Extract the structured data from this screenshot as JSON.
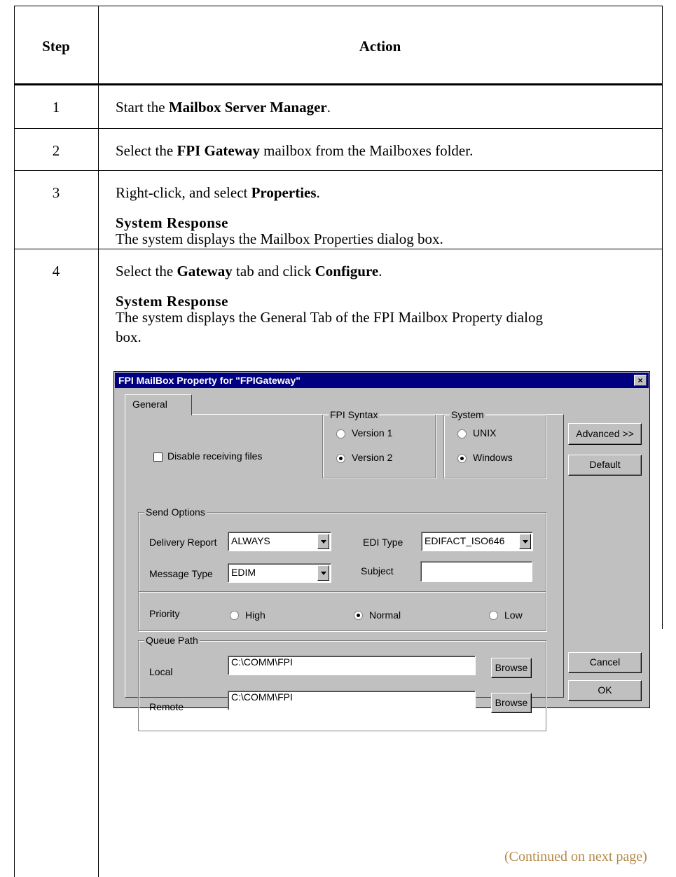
{
  "table": {
    "header_step": "Step",
    "header_action": "Action",
    "rows": [
      {
        "step": "1",
        "pre": "Start the ",
        "bold": "Mailbox Server Manager",
        "post": "."
      },
      {
        "step": "2",
        "pre": "Select the ",
        "bold": "FPI Gateway",
        "post": " mailbox from the Mailboxes folder."
      },
      {
        "step": "3",
        "pre": "Right-click, and select ",
        "bold": "Properties",
        "post": ".",
        "response_heading": "System Response",
        "response_text": "The system displays the Mailbox Properties dialog box."
      },
      {
        "step": "4",
        "pre": "Select the ",
        "bold": "Gateway",
        "mid": " tab and click ",
        "bold2": "Configure",
        "post": ".",
        "response_heading": "System Response",
        "response_text_line1": "The system displays the General Tab of the FPI Mailbox Property dialog",
        "response_text_line2": "box."
      }
    ],
    "continued": "(Continued on next page)"
  },
  "dialog": {
    "title": "FPI MailBox Property for \"FPIGateway\"",
    "close_symbol": "×",
    "tab_general": "General",
    "disable_receiving": "Disable receiving files",
    "fpi_syntax": {
      "label": "FPI Syntax",
      "v1": "Version 1",
      "v2": "Version 2",
      "selected": "Version 2"
    },
    "system": {
      "label": "System",
      "unix": "UNIX",
      "windows": "Windows",
      "selected": "Windows"
    },
    "send_options": {
      "label": "Send Options",
      "delivery_report_label": "Delivery Report",
      "delivery_report_value": "ALWAYS",
      "edi_type_label": "EDI Type",
      "edi_type_value": "EDIFACT_ISO646",
      "message_type_label": "Message Type",
      "message_type_value": "EDIM",
      "subject_label": "Subject",
      "subject_value": "",
      "priority_label": "Priority",
      "priority_high": "High",
      "priority_normal": "Normal",
      "priority_low": "Low",
      "priority_selected": "Normal"
    },
    "queue_path": {
      "label": "Queue Path",
      "local_label": "Local",
      "local_value": "C:\\COMM\\FPI",
      "remote_label": "Remote",
      "remote_value": "C:\\COMM\\FPI",
      "browse": "Browse"
    },
    "buttons": {
      "advanced": "Advanced >>",
      "default": "Default",
      "cancel": "Cancel",
      "ok": "OK"
    }
  }
}
